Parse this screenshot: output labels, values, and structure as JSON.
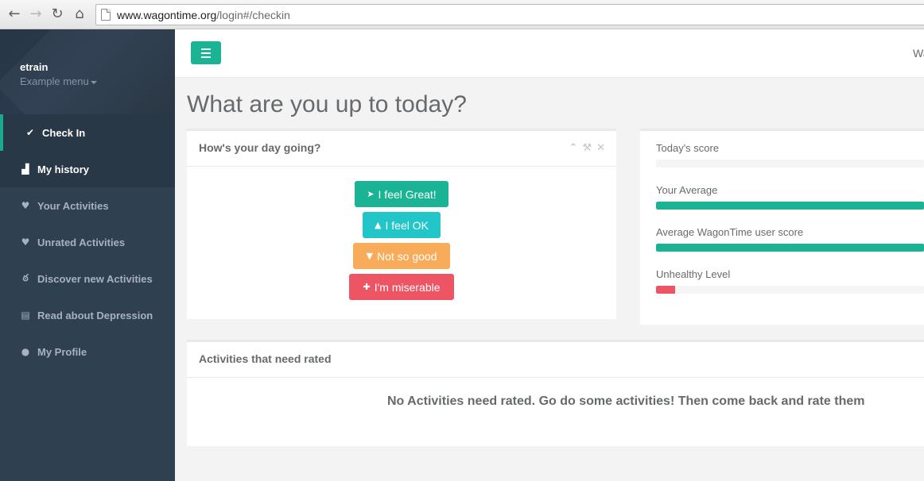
{
  "browser": {
    "url_host": "www.wagontime.org",
    "url_path": "/login#/checkin",
    "back_icon": "arrow-left-icon",
    "forward_icon": "arrow-right-icon",
    "reload_icon": "reload-icon",
    "home_icon": "home-icon"
  },
  "sidebar": {
    "user_name": "etrain",
    "user_menu": "Example menu",
    "items": [
      {
        "label": "Check In",
        "icon": "check-icon",
        "glyph": "✔"
      },
      {
        "label": "My history",
        "icon": "area-chart-icon",
        "glyph": "▟"
      },
      {
        "label": "Your Activities",
        "icon": "heart-icon",
        "glyph": "♥"
      },
      {
        "label": "Unrated Activities",
        "icon": "heart-icon",
        "glyph": "♥"
      },
      {
        "label": "Discover new Activities",
        "icon": "bicycle-icon",
        "glyph": "ఠ"
      },
      {
        "label": "Read about Depression",
        "icon": "book-icon",
        "glyph": "▤"
      },
      {
        "label": "My Profile",
        "icon": "user-icon",
        "glyph": "●"
      }
    ]
  },
  "topbar": {
    "right_text": "Wa"
  },
  "main": {
    "page_title": "What are you up to today?",
    "mood": {
      "title": "How's your day going?",
      "buttons": [
        {
          "label": "I feel Great!",
          "icon": "rocket-icon",
          "glyph": "➤"
        },
        {
          "label": "I feel OK",
          "icon": "thumbs-up-icon",
          "glyph": "▲"
        },
        {
          "label": "Not so good",
          "icon": "thumbs-down-icon",
          "glyph": "▼"
        },
        {
          "label": "I'm miserable",
          "icon": "ambulance-icon",
          "glyph": "✚"
        }
      ]
    },
    "scores": [
      {
        "label": "Today's score",
        "value": 0,
        "color": "#1ab394"
      },
      {
        "label": "Your Average",
        "value": 1.0,
        "color": "#1ab394"
      },
      {
        "label": "Average WagonTime user score",
        "value": 1.0,
        "color": "#1ab394"
      },
      {
        "label": "Unhealthy Level",
        "value": 0.07,
        "color": "#ed5565"
      }
    ],
    "rate": {
      "title": "Activities that need rated",
      "empty_message": "No Activities need rated. Go do some activities! Then come back and rate them"
    }
  },
  "colors": {
    "primary": "#1ab394",
    "info": "#23c6c8",
    "warning": "#f8ac59",
    "danger": "#ed5565",
    "sidebar": "#2f4050"
  }
}
